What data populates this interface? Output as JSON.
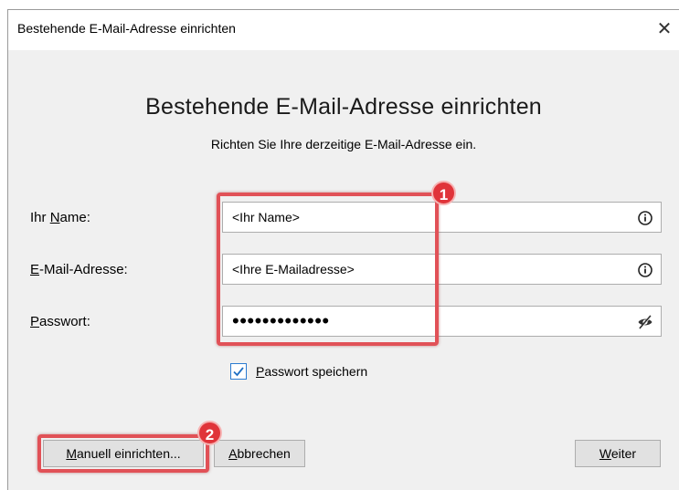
{
  "window": {
    "title": "Bestehende E-Mail-Adresse einrichten",
    "close_glyph": "✕"
  },
  "heading": "Bestehende E-Mail-Adresse einrichten",
  "subheading": "Richten Sie Ihre derzeitige E-Mail-Adresse ein.",
  "form": {
    "name": {
      "label_mnemonic": "Ihr ",
      "label_underlined": "N",
      "label_rest": "ame:",
      "value": "<Ihr Name>"
    },
    "email": {
      "label_underlined": "E",
      "label_rest": "-Mail-Adresse:",
      "value": "<Ihre E-Mailadresse>"
    },
    "password": {
      "label_underlined": "P",
      "label_rest": "asswort:",
      "value": "•••••••••••••"
    }
  },
  "save_password": {
    "checked": true,
    "label_underlined": "P",
    "label_rest": "asswort speichern"
  },
  "buttons": {
    "manual": {
      "underlined": "M",
      "rest": "anuell einrichten..."
    },
    "cancel": {
      "underlined": "A",
      "rest": "bbrechen"
    },
    "next": {
      "underlined": "W",
      "rest": "eiter"
    }
  },
  "annotations": {
    "badge1": "1",
    "badge2": "2",
    "color": "#e15157"
  },
  "icons": [
    "info-icon",
    "eye-slash-icon",
    "checkmark-icon",
    "close-icon"
  ]
}
